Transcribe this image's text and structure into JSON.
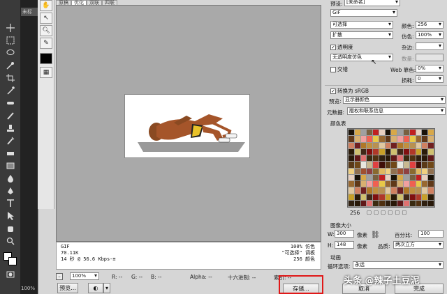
{
  "toolbar": {
    "doc_tab": "未标",
    "zoom_status": "100%",
    "tools": [
      "move-icon",
      "marquee-icon",
      "lasso-icon",
      "magic-wand-icon",
      "crop-icon",
      "eyedropper-icon",
      "healing-icon",
      "brush-icon",
      "stamp-icon",
      "history-brush-icon",
      "eraser-icon",
      "gradient-icon",
      "blur-icon",
      "dodge-icon",
      "pen-icon",
      "type-icon",
      "path-select-icon",
      "shape-icon",
      "hand-icon",
      "zoom-icon"
    ]
  },
  "view_tabs": [
    "原稿",
    "优化",
    "双联",
    "四联"
  ],
  "dialog_tools": [
    "hand-icon",
    "slice-select-icon",
    "zoom-icon",
    "eyedropper-icon",
    "color-swatch",
    "toggle-slices-icon"
  ],
  "info": {
    "format": "GIF",
    "size": "70.11K",
    "time": "14 秒 @ 56.6 Kbps",
    "menu_glyph": "-≡",
    "dither": "100% 仿色",
    "palette": "\"可选择\" 调板",
    "colors": "256 颜色"
  },
  "bottom": {
    "zoom": "100%",
    "r": "R: --",
    "g": "G: --",
    "b": "B: --",
    "alpha": "Alpha: --",
    "hex": "十六进制: --",
    "index": "索引: --",
    "preview_btn": "预览...",
    "save_btn": "存储...",
    "cancel_btn": "取消",
    "done_btn": "完成"
  },
  "settings": {
    "preset_label": "预设:",
    "preset_value": "[未命名]",
    "format": "GIF",
    "reduction": "可选择",
    "colors_label": "颜色:",
    "colors_value": "256",
    "dither_algo": "扩散",
    "dither_label": "仿色:",
    "dither_value": "100%",
    "transparency": "透明度",
    "matte_label": "杂边:",
    "trans_dither": "无透明度仿色",
    "amount_label": "数量:",
    "interlaced": "交错",
    "web_snap_label": "Web 靠色:",
    "web_snap_value": "0%",
    "lossy_label": "损耗:",
    "lossy_value": "0",
    "convert_srgb": "转换为 sRGB",
    "preview_label": "预览:",
    "preview_value": "显示器颜色",
    "metadata_label": "元数据:",
    "metadata_value": "版权和联系信息",
    "color_table": "颜色表",
    "color_count": "256",
    "image_size": "图像大小",
    "w_label": "W:",
    "w_value": "300",
    "w_unit": "像素",
    "h_label": "H:",
    "h_value": "148",
    "h_unit": "像素",
    "percent_label": "百分比:",
    "percent_value": "100",
    "quality_label": "品质:",
    "quality_value": "两次立方",
    "animation": "动画",
    "loop_label": "循环选项:",
    "loop_value": "永远"
  },
  "watermark": "头条 @辣子土豆泥",
  "swatch_colors": [
    "#1a1208",
    "#5a3a18",
    "#c8a028",
    "#e8c848",
    "#8a6a30",
    "#3a2a10",
    "#b07828",
    "#d8a848",
    "#704818",
    "#2a1a08",
    "#986830",
    "#e0b860",
    "#503010",
    "#c09040",
    "#a0a0a0",
    "#e8e8e0",
    "#d0c070",
    "#603818",
    "#f0d080",
    "#302010",
    "#b89050",
    "#786040",
    "#c8b890",
    "#402818",
    "#d8b070",
    "#907050",
    "#281808",
    "#e0c8a0",
    "#c02020",
    "#e04040",
    "#801010",
    "#f0a0a0",
    "#a05030",
    "#601818",
    "#d08060",
    "#e8d0c0",
    "#401008",
    "#b03828",
    "#f06050",
    "#904040",
    "#e07070",
    "#702020"
  ]
}
